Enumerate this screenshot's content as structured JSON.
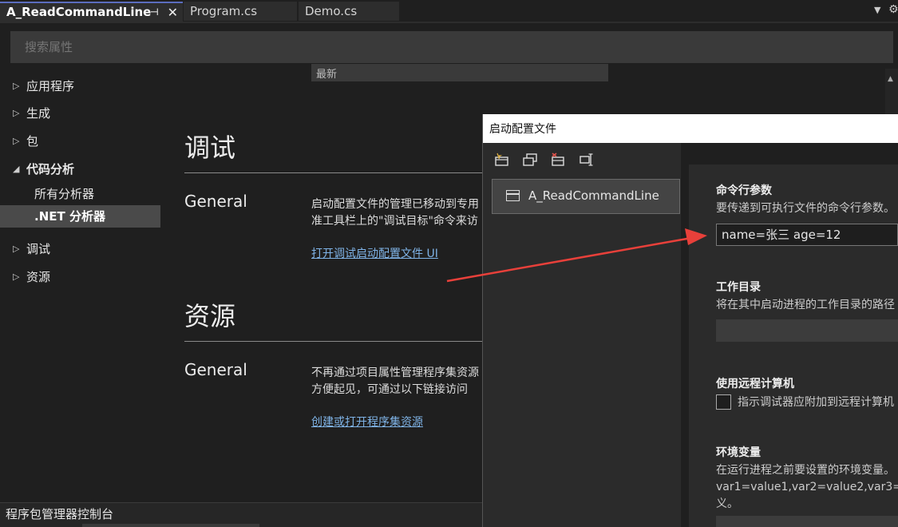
{
  "tabs": [
    {
      "label": "A_ReadCommandLine",
      "active": true
    },
    {
      "label": "Program.cs",
      "active": false
    },
    {
      "label": "Demo.cs",
      "active": false
    }
  ],
  "search": {
    "placeholder": "搜索属性"
  },
  "nav": {
    "items": [
      {
        "label": "应用程序",
        "arrow": "▷"
      },
      {
        "label": "生成",
        "arrow": "▷"
      },
      {
        "label": "包",
        "arrow": "▷"
      },
      {
        "label": "代码分析",
        "arrow": "◢"
      },
      {
        "label": "调试",
        "arrow": "▷"
      },
      {
        "label": "资源",
        "arrow": "▷"
      }
    ],
    "subitems": [
      {
        "label": "所有分析器"
      },
      {
        "label": ".NET 分析器"
      }
    ]
  },
  "dropdown_value": "最新",
  "debug": {
    "heading": "调试",
    "general": "General",
    "desc_line1": "启动配置文件的管理已移动到专用",
    "desc_line2": "准工具栏上的\"调试目标\"命令来访",
    "link": "打开调试启动配置文件 UI"
  },
  "resources": {
    "heading": "资源",
    "general": "General",
    "desc_line1": "不再通过项目属性管理程序集资源",
    "desc_line2": "方便起见，可通过以下链接访问",
    "link": "创建或打开程序集资源"
  },
  "bottom_panel": {
    "label": "程序包管理器控制台"
  },
  "dialog": {
    "title": "启动配置文件",
    "profile": "A_ReadCommandLine",
    "cmd_args": {
      "heading": "命令行参数",
      "desc": "要传递到可执行文件的命令行参数。",
      "value": "name=张三 age=12"
    },
    "workdir": {
      "heading": "工作目录",
      "desc": "将在其中启动进程的工作目录的路径"
    },
    "remote": {
      "heading": "使用远程计算机",
      "checkbox_label": "指示调试器应附加到远程计算机"
    },
    "env": {
      "heading": "环境变量",
      "desc_line1": "在运行进程之前要设置的环境变量。",
      "desc_line2": "var1=value1,var2=value2,var3=",
      "desc_line3": "义。"
    }
  },
  "colors": {
    "accent": "#5b6dbe",
    "link": "#7fb3e6",
    "arrow": "#e8403a"
  }
}
